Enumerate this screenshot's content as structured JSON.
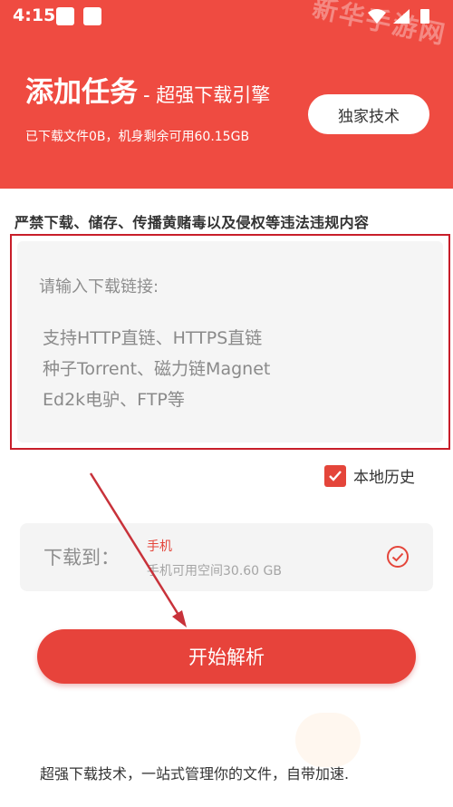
{
  "status_bar": {
    "time": "4:15",
    "watermark": "新华手游网"
  },
  "header": {
    "title": "添加任务",
    "subtitle": "- 超强下载引擎",
    "storage_info": "已下载文件0B，机身剩余可用60.15GB",
    "exclusive_button": "独家技术"
  },
  "warning": "严禁下载、储存、传播黄赌毒以及侵权等违法违规内容",
  "link_input": {
    "placeholder": "请输入下载链接:",
    "hints": [
      "支持HTTP直链、HTTPS直链",
      "种子Torrent、磁力链Magnet",
      "Ed2k电驴、FTP等"
    ]
  },
  "history": {
    "label": "本地历史",
    "checked": true
  },
  "download_to": {
    "label": "下载到：",
    "target": "手机",
    "space": "手机可用空间30.60 GB"
  },
  "start_button": "开始解析",
  "footer": "超强下载技术，一站式管理你的文件，自带加速.",
  "colors": {
    "accent": "#ef4b41",
    "highlight_border": "#c81e2a",
    "arrow": "#c8323a"
  }
}
